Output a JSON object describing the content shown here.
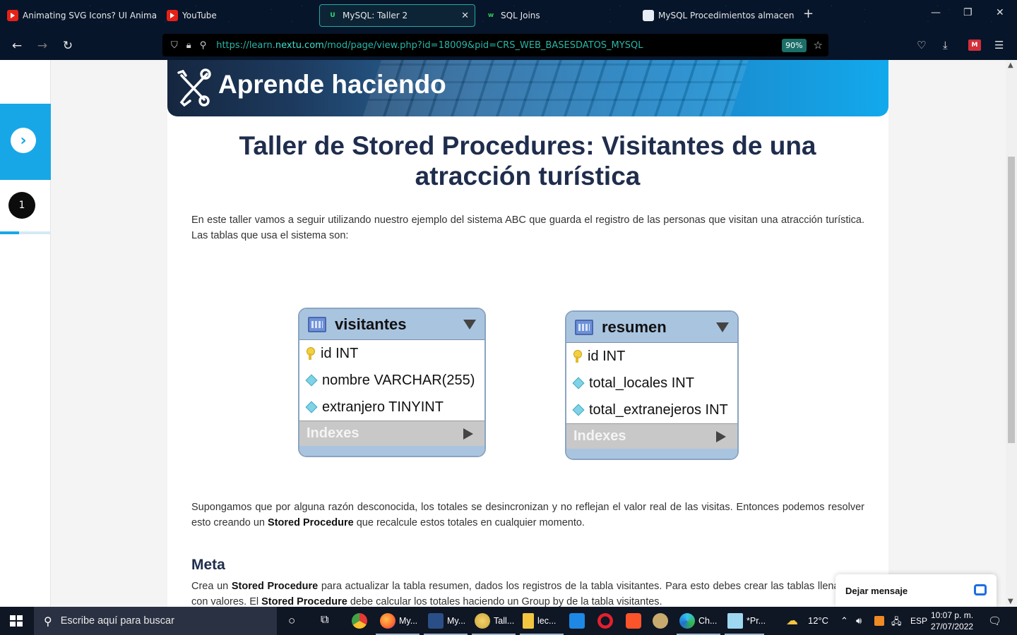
{
  "browser": {
    "tabs": [
      {
        "title": "Animating SVG Icons? UI Animatio",
        "favicon": "youtube-icon"
      },
      {
        "title": "YouTube",
        "favicon": "youtube-icon"
      },
      {
        "title": "MySQL: Taller 2",
        "favicon": "nextu-icon",
        "active": true
      },
      {
        "title": "SQL Joins",
        "favicon": "w3-icon"
      },
      {
        "title": "MySQL Procedimientos almacena",
        "favicon": "mysql-icon"
      }
    ],
    "url_prefix": "https://learn.",
    "url_domain": "nextu.com",
    "url_rest": "/mod/page/view.php?id=18009&pid=CRS_WEB_BASESDATOS_MYSQL",
    "zoom": "90%",
    "colors": {
      "accent": "#28a8a0",
      "url": "#29b6a8"
    }
  },
  "sidebar": {
    "step_number": "1",
    "progress_fraction": 0.38,
    "colors": {
      "accent": "#18a7e6"
    }
  },
  "banner": {
    "title": "Aprende haciendo"
  },
  "page": {
    "title": "Taller de Stored Procedures: Visitantes de una atracción turística",
    "intro": "En este taller vamos a seguir utilizando nuestro ejemplo del sistema ABC que guarda el registro de las personas que visitan una atracción turística. Las tablas que usa el sistema son:",
    "para2_a": "Supongamos que por alguna razón desconocida, los totales se desincronizan y no reflejan el valor real de las visitas. Entonces podemos resolver esto creando un ",
    "para2_b": "Stored Procedure",
    "para2_c": " que recalcule estos totales en cualquier momento.",
    "meta_heading": "Meta",
    "meta_a": "Crea un ",
    "meta_b": "Stored Procedure",
    "meta_c": " para actualizar la tabla resumen, dados los registros de la tabla visitantes. Para esto debes crear las tablas llenándola con valores. El ",
    "meta_d": "Stored Procedure",
    "meta_e": " debe calcular los totales haciendo un Group by de la tabla visitantes."
  },
  "tables": [
    {
      "name": "visitantes",
      "columns": [
        {
          "label": "id INT",
          "icon": "key-icon"
        },
        {
          "label": "nombre VARCHAR(255)",
          "icon": "column-icon"
        },
        {
          "label": "extranjero TINYINT",
          "icon": "column-icon"
        }
      ],
      "indexes_label": "Indexes"
    },
    {
      "name": "resumen",
      "columns": [
        {
          "label": "id INT",
          "icon": "key-icon"
        },
        {
          "label": "total_locales INT",
          "icon": "column-icon"
        },
        {
          "label": "total_extranejeros INT",
          "icon": "column-icon"
        }
      ],
      "indexes_label": "Indexes"
    }
  ],
  "chat": {
    "label": "Dejar mensaje"
  },
  "taskbar": {
    "search_placeholder": "Escribe aquí para buscar",
    "apps": [
      {
        "label": "My..."
      },
      {
        "label": "My..."
      },
      {
        "label": "Tall..."
      },
      {
        "label": "lec..."
      },
      {
        "label": "Ch..."
      },
      {
        "label": "*Pr..."
      }
    ],
    "weather": "12°C",
    "language": "ESP",
    "time": "10:07 p. m.",
    "date": "27/07/2022"
  }
}
